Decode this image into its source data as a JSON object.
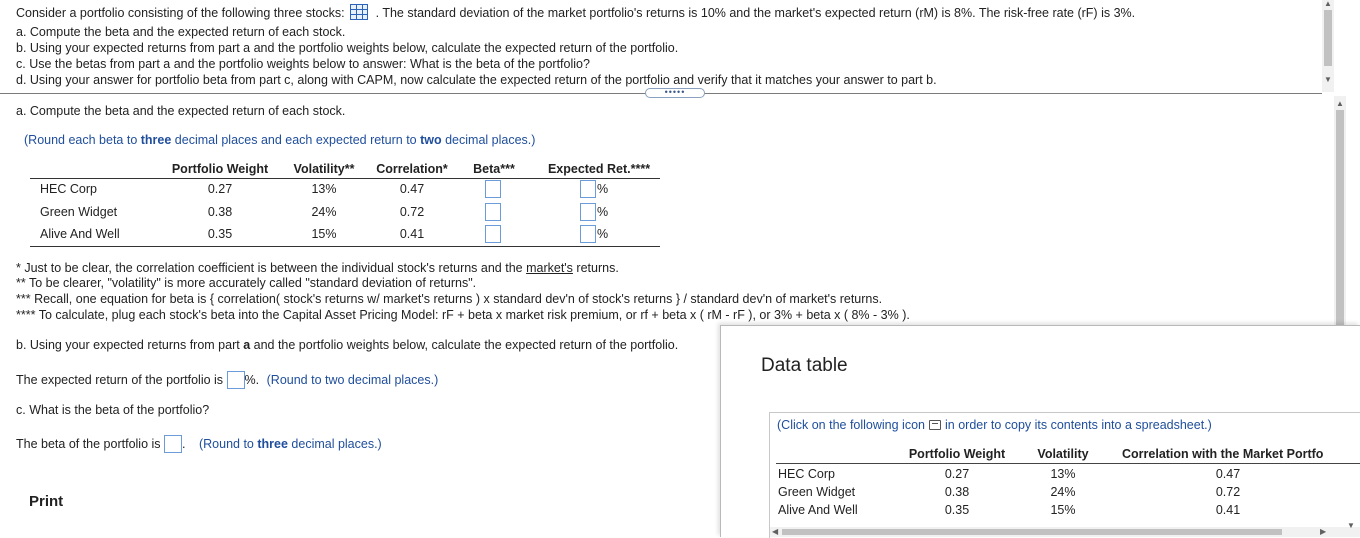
{
  "question": {
    "intro_before_icon": "Consider a portfolio consisting of the following three stocks:",
    "intro_after_icon": ". The standard deviation of the market portfolio's returns is 10% and the market's expected return (rM) is 8%. The risk-free rate (rF) is 3%.",
    "items": [
      "a. Compute the beta and the expected return of each stock.",
      "b. Using your expected returns from part a and the portfolio weights below, calculate the expected return of the portfolio.",
      "c.  Use the betas from part a and the portfolio weights below to answer: What is the beta of the portfolio?",
      "d. Using your answer for portfolio beta from part c, along with CAPM, now calculate the expected return of the portfolio and verify that it matches your answer to part b."
    ],
    "expand_dots": "•••••"
  },
  "part_a": {
    "title": "a. Compute the beta and the expected return of each stock.",
    "round_open": "(Round each beta to ",
    "round_three": "three",
    "round_mid": " decimal places and each expected return to ",
    "round_two": "two",
    "round_close": " decimal places.)",
    "headers": [
      "Portfolio Weight",
      "Volatility**",
      "Correlation*",
      "Beta***",
      "Expected Ret.****"
    ],
    "rows": [
      {
        "name": "HEC Corp",
        "weight": "0.27",
        "volatility": "13%",
        "correlation": "0.47"
      },
      {
        "name": "Green Widget",
        "weight": "0.38",
        "volatility": "24%",
        "correlation": "0.72"
      },
      {
        "name": "Alive And Well",
        "weight": "0.35",
        "volatility": "15%",
        "correlation": "0.41"
      }
    ],
    "pct_sign": "%"
  },
  "notes": {
    "n1_before": "* Just to be clear, the correlation coefficient is between the individual stock's returns and the ",
    "n1_link": "market's",
    "n1_after": " returns.",
    "n2": "** To be clearer, \"volatility\" is more accurately called \"standard deviation of returns\".",
    "n3": "*** Recall, one equation for beta is { correlation( stock's returns w/ market's returns ) x standard dev'n of stock's returns } / standard dev'n of market's returns.",
    "n4": "**** To calculate, plug each stock's beta into the Capital Asset Pricing Model: rF + beta x market risk premium, or rf + beta x ( rM - rF ), or 3% + beta x ( 8% - 3% )."
  },
  "part_b": {
    "title_before": "b. Using your expected returns from part ",
    "title_bold": "a",
    "title_after": " and the portfolio weights below, calculate the expected return of the portfolio.",
    "answer_before": "The expected return of the portfolio is ",
    "answer_after": "%.",
    "hint": "(Round to two decimal places.)"
  },
  "part_c": {
    "title": "c. What is the beta of the portfolio?",
    "answer_before": "The beta of the portfolio is ",
    "answer_after": ".",
    "hint_before": "(Round to ",
    "hint_bold": "three",
    "hint_after": " decimal places.)"
  },
  "print_label": "Print",
  "data_table": {
    "title": "Data table",
    "instruction_before": "(Click on the following icon",
    "instruction_after": "in order to copy its contents into a spreadsheet.)",
    "headers": [
      "Portfolio Weight",
      "Volatility",
      "Correlation with the Market Portfo"
    ],
    "rows": [
      {
        "name": "HEC Corp",
        "weight": "0.27",
        "volatility": "13%",
        "correlation": "0.47"
      },
      {
        "name": "Green Widget",
        "weight": "0.38",
        "volatility": "24%",
        "correlation": "0.72"
      },
      {
        "name": "Alive And Well",
        "weight": "0.35",
        "volatility": "15%",
        "correlation": "0.41"
      }
    ]
  },
  "icons": {
    "table": "table-grid-icon",
    "copy": "copy-icon",
    "scroll_up": "▲",
    "scroll_down": "▼",
    "scroll_left": "◀",
    "scroll_right": "▶"
  },
  "colors": {
    "link_blue": "#1f4e9c",
    "input_border": "#6b9bd8"
  }
}
